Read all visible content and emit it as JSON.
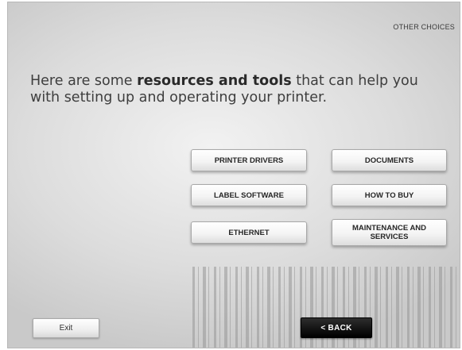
{
  "header": {
    "other_choices": "OTHER CHOICES"
  },
  "headline": {
    "prefix": "Here are some ",
    "emphasis": "resources and tools",
    "suffix": " that can help you with setting up and operating your printer."
  },
  "buttons": {
    "printer_drivers": "PRINTER DRIVERS",
    "documents": "DOCUMENTS",
    "label_software": "LABEL SOFTWARE",
    "how_to_buy": "HOW TO BUY",
    "ethernet": "ETHERNET",
    "maintenance_line1": "MAINTENANCE AND",
    "maintenance_line2": "SERVICES"
  },
  "footer": {
    "exit": "Exit",
    "back": "< BACK"
  }
}
